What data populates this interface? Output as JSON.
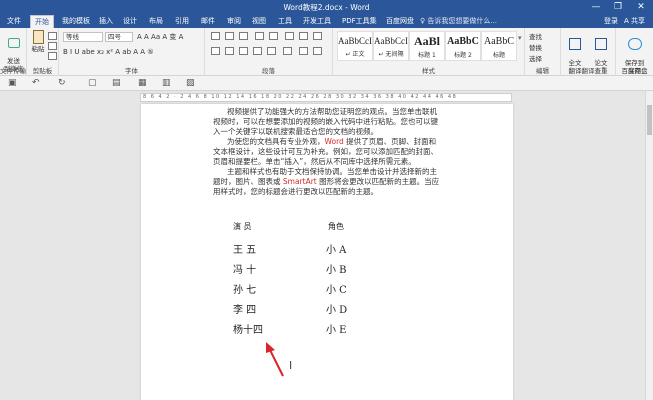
{
  "window": {
    "title": "Word教程2.docx - Word",
    "controls": [
      "—",
      "❐",
      "✕"
    ]
  },
  "tabs": [
    {
      "label": "文件",
      "active": false
    },
    {
      "label": "开始",
      "active": true
    },
    {
      "label": "我的模板",
      "active": false
    },
    {
      "label": "插入",
      "active": false
    },
    {
      "label": "设计",
      "active": false
    },
    {
      "label": "布局",
      "active": false
    },
    {
      "label": "引用",
      "active": false
    },
    {
      "label": "邮件",
      "active": false
    },
    {
      "label": "审阅",
      "active": false
    },
    {
      "label": "视图",
      "active": false
    },
    {
      "label": "工具",
      "active": false
    },
    {
      "label": "开发工具",
      "active": false
    },
    {
      "label": "PDF工具集",
      "active": false
    },
    {
      "label": "百度网盘",
      "active": false
    }
  ],
  "tellme": "♀ 告诉我您想要做什么...",
  "account": {
    "login": "登录",
    "share": "A 共享"
  },
  "ribbon": {
    "send": {
      "label": "发送\n到微信",
      "group": "文件传输"
    },
    "clipboard": {
      "paste": "粘贴",
      "group": "剪贴板"
    },
    "font": {
      "name": "等线",
      "size": "四号",
      "group": "字体",
      "row1": "A A Aa A 变 A",
      "row2": "B I U abe x₂ x² A ab A A ⑤"
    },
    "paragraph": {
      "group": "段落"
    },
    "styles": {
      "group": "样式",
      "items": [
        {
          "sample": "AaBbCcI",
          "name": "↵ 正文"
        },
        {
          "sample": "AaBbCcI",
          "name": "↵ 无间隔"
        },
        {
          "sample": "AaBl",
          "name": "标题 1"
        },
        {
          "sample": "AaBbC",
          "name": "标题 2"
        },
        {
          "sample": "AaBbC",
          "name": "标题"
        }
      ]
    },
    "editing": {
      "find": "查找",
      "replace": "替换",
      "select": "选择",
      "group": "编辑"
    },
    "translate": {
      "full": "全文\n翻译",
      "paper": "论文\n查重",
      "group": "翻译",
      "save": "保存到\n百度网盘",
      "save_group": "保存"
    }
  },
  "ruler": {
    "numbers": "8 6 4 2 · 2 4 6 8 10 12 14 16 18 20 22 24 26 28 30 32 34 36 38 40 42 44 46 48"
  },
  "document": {
    "p1": "视频提供了功能强大的方法帮助您证明您的观点。当您单击联机视频时，可以在想要添加的视频的嵌入代码中进行粘贴。您也可以键入一个关键字以联机搜索最适合您的文档的视频。",
    "p2_before": "为使您的文档具有专业外观，",
    "p2_word": "Word",
    "p2_after": " 提供了页眉、页脚、封面和文本框设计，这些设计可互为补充。例如，您可以添加匹配的封面、页眉和提要栏。单击“插入”，然后从不同库中选择所需元素。",
    "p3_before": "主题和样式也有助于文档保持协调。当您单击设计并选择新的主题时，图片、图表或 ",
    "p3_smart": "SmartArt",
    "p3_after": " 图形将会更改以匹配新的主题。当应用样式时，您的标题会进行更改以匹配新的主题。",
    "table": {
      "headers": [
        "演 员",
        "角色"
      ],
      "rows": [
        [
          "王 五",
          "小 A"
        ],
        [
          "冯 十",
          "小 B"
        ],
        [
          "孙 七",
          "小 C"
        ],
        [
          "李 四",
          "小 D"
        ],
        [
          "杨十四",
          "小 E"
        ]
      ]
    }
  },
  "colors": {
    "accent": "#2b579a",
    "arrow": "#d9262c",
    "red_text": "#d12c2c"
  }
}
